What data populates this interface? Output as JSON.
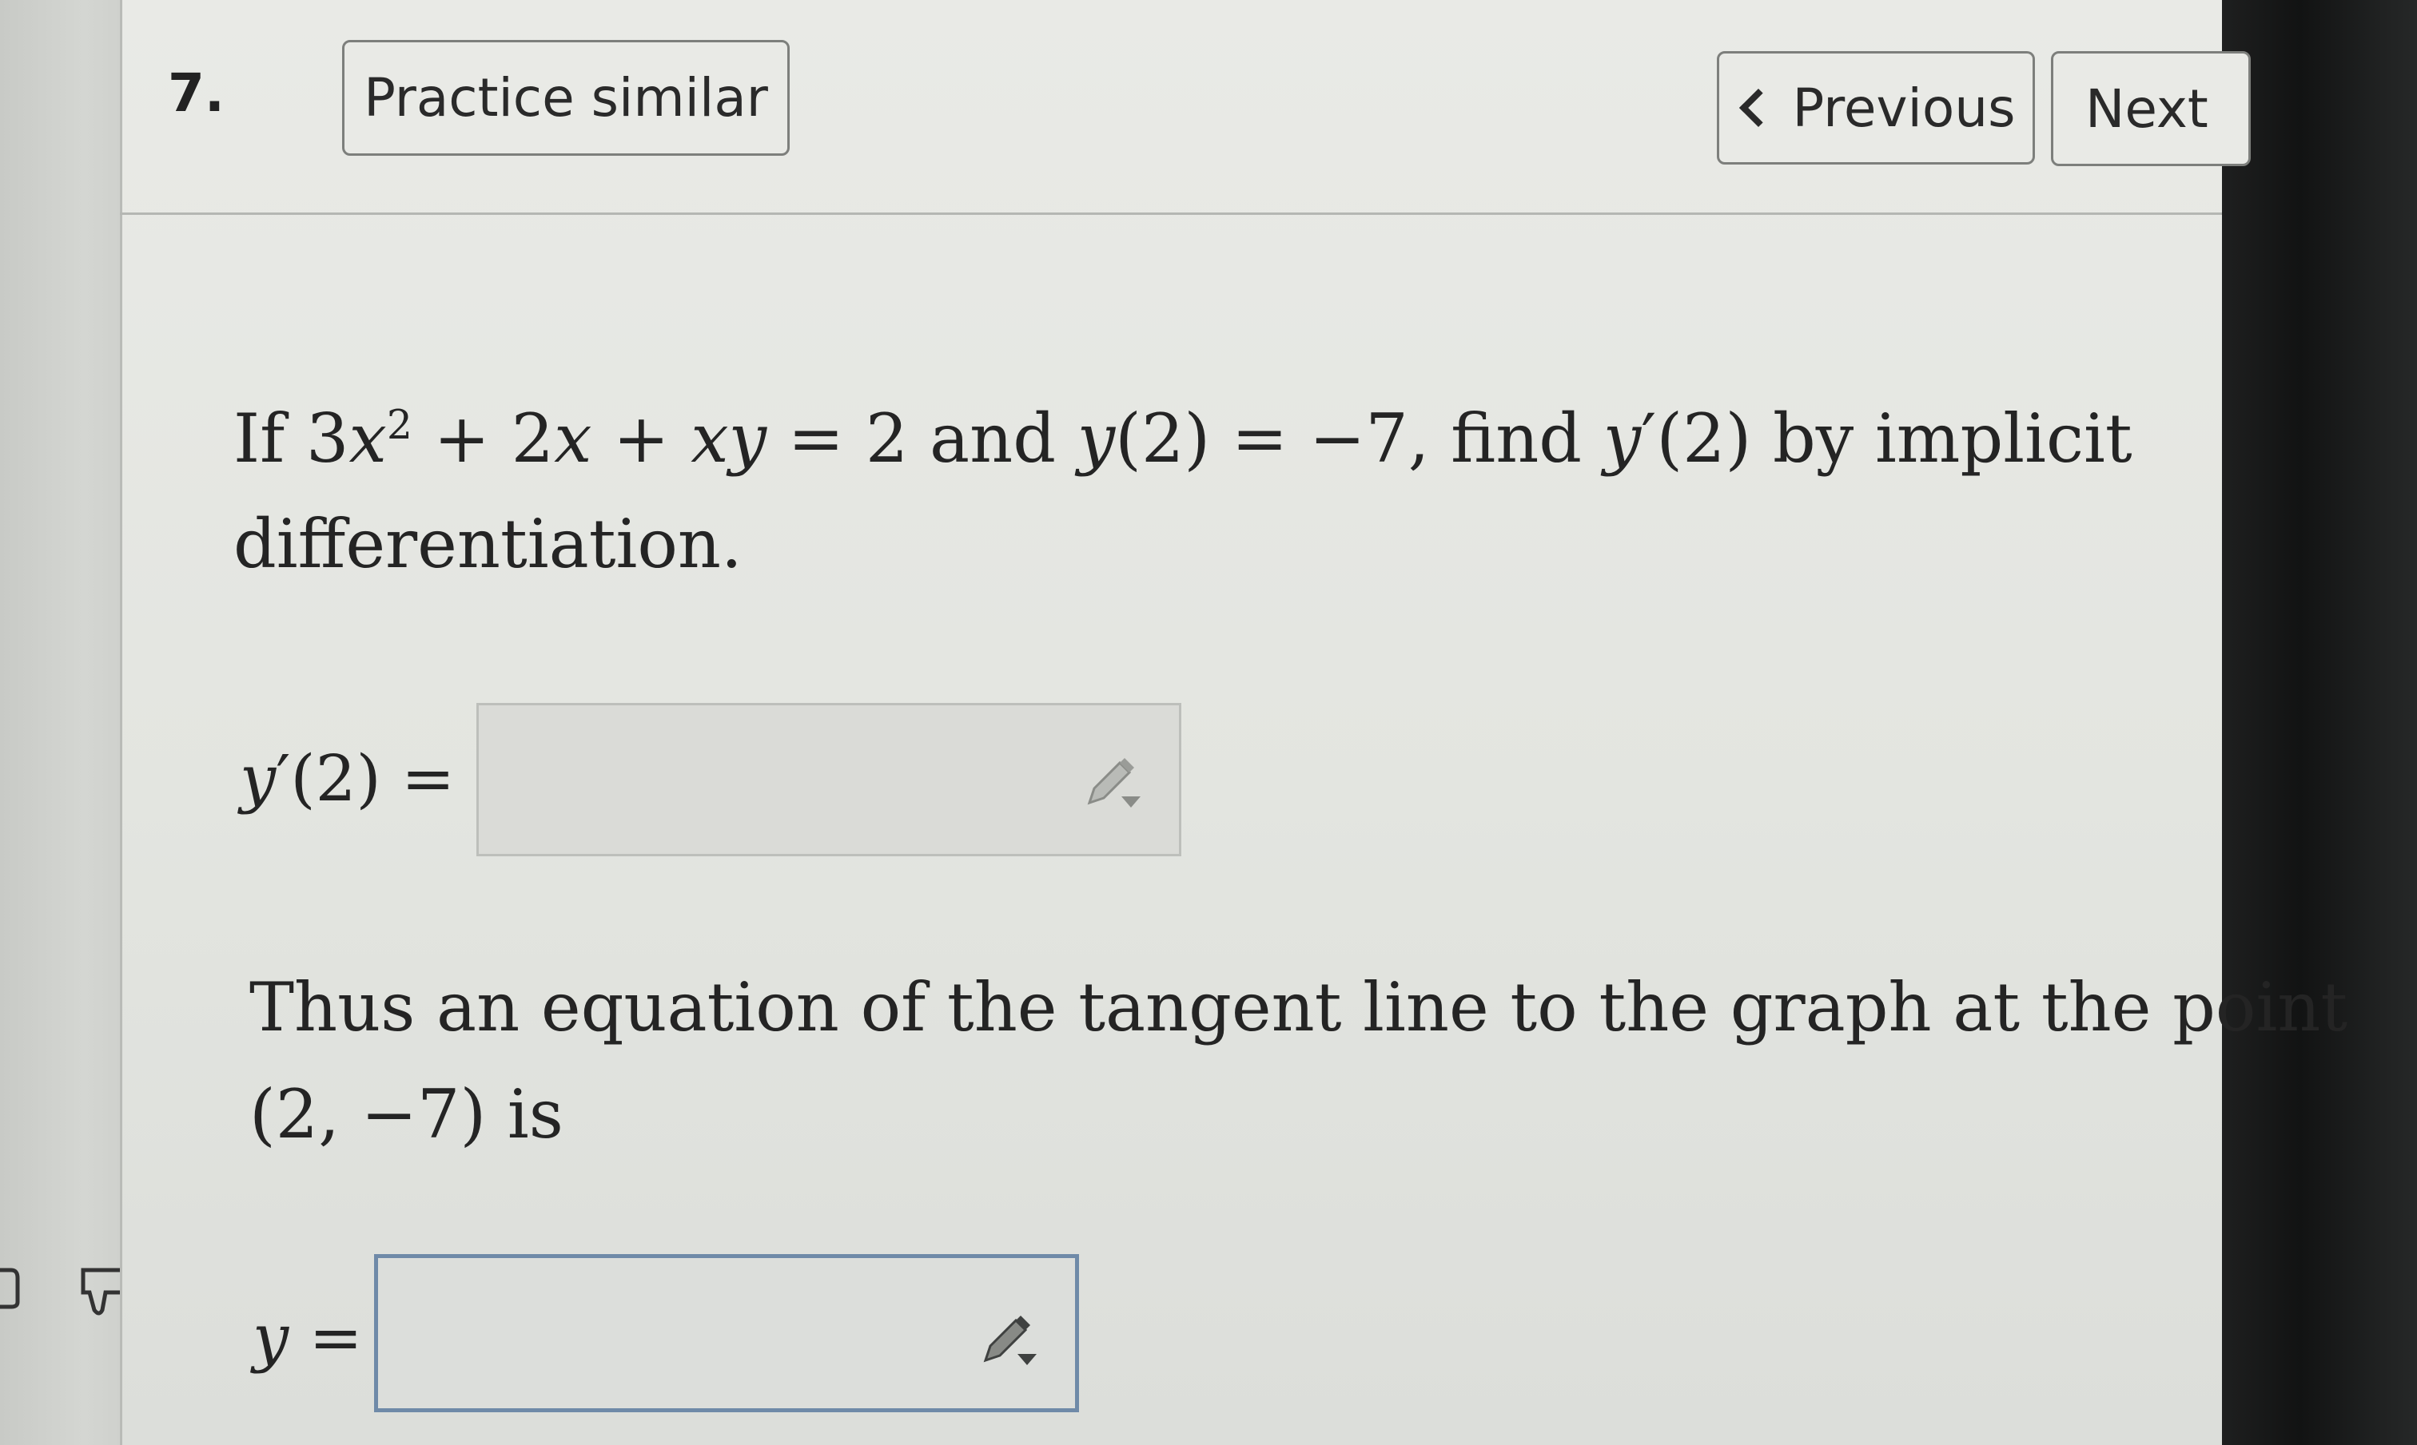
{
  "header": {
    "question_number": "7.",
    "practice_label": "Practice similar",
    "previous_label": "Previous",
    "next_label": "Next"
  },
  "question": {
    "line1_if": "If",
    "line1_and": "and",
    "line1_find": "find",
    "line1_end": "by implicit",
    "line2": "differentiation.",
    "line3": "Thus an equation of the tangent line to the graph at the point",
    "line4_point": "(2, −7)",
    "line4_is": "is"
  },
  "answers": {
    "yprime_value": "",
    "tangent_value": ""
  },
  "icons": {
    "edit": "pencil-icon",
    "thumbs_up": "thumbs-up-icon",
    "thumbs_down": "thumbs-down-icon"
  }
}
